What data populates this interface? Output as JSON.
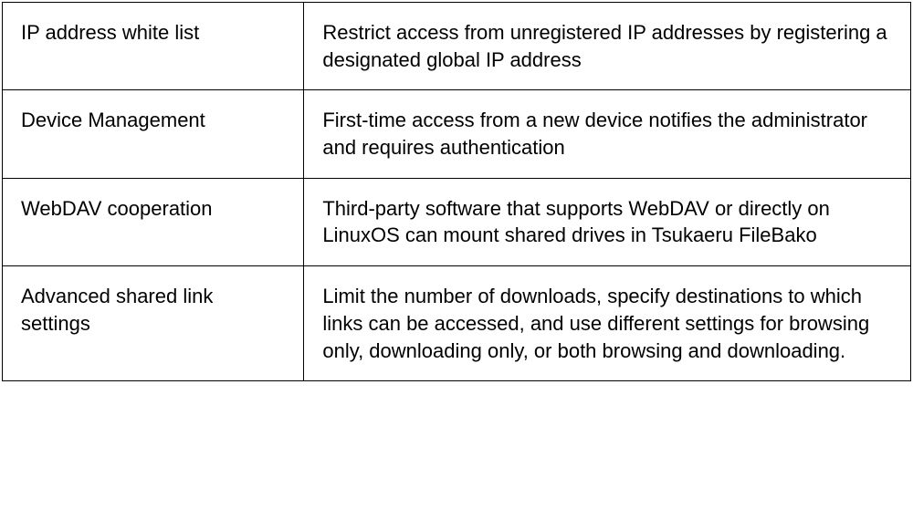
{
  "features": [
    {
      "name": "IP address white list",
      "description": "Restrict access from unregistered IP addresses by registering a designated global IP address"
    },
    {
      "name": "Device Management",
      "description": "First-time access from a new device notifies the administrator and requires authentication"
    },
    {
      "name": "WebDAV cooperation",
      "description": "Third-party software that supports WebDAV or directly on LinuxOS can mount shared drives in Tsukaeru FileBako"
    },
    {
      "name": "Advanced shared link settings",
      "description": "Limit the number of downloads, specify destinations to which links can be accessed, and use different settings for browsing only, downloading only, or both browsing and downloading."
    }
  ]
}
